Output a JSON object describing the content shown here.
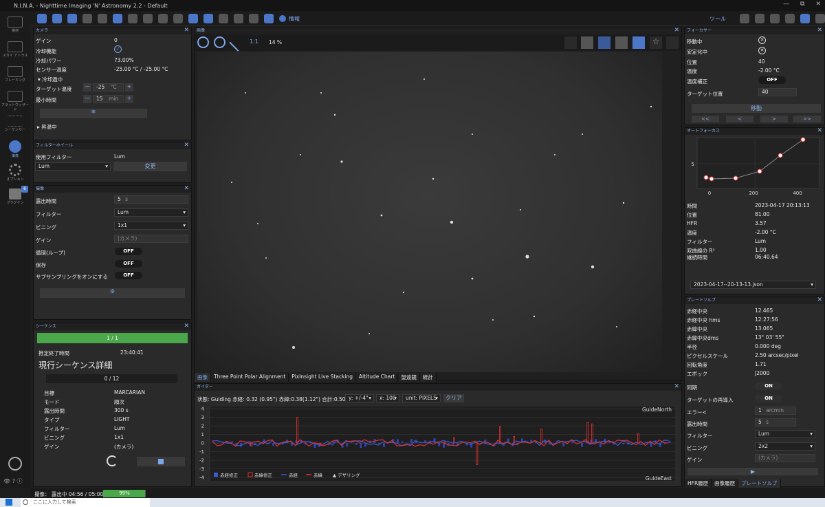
{
  "window": {
    "title": "N.I.N.A. - Nighttime Imaging 'N' Astronomy 2.2  -  Default",
    "controls": [
      "—",
      "⧉",
      "✕"
    ]
  },
  "sidebar": {
    "items": [
      {
        "label": "機材",
        "icon": "telescope-icon"
      },
      {
        "label": "スカイ アトラス",
        "icon": "map-icon"
      },
      {
        "label": "フレーミング",
        "icon": "frame-icon"
      },
      {
        "label": "フラットウィザード",
        "icon": "flat-icon"
      },
      {
        "label": "シーケンサー",
        "icon": "list-icon"
      },
      {
        "label": "撮像",
        "icon": "camera-icon"
      },
      {
        "label": "オプション",
        "icon": "gear-icon"
      },
      {
        "label": "プラグイン",
        "icon": "puzzle-icon"
      }
    ],
    "plugin_badge": "6"
  },
  "toolbar": {
    "info_label": "情報",
    "tools_label": "ツール"
  },
  "camera": {
    "header": "カメラ",
    "gain_label": "ゲイン",
    "gain": "0",
    "cooling_label": "冷却機能",
    "power_label": "冷却パワー",
    "power": "73.00%",
    "temp_label": "センサー温度",
    "temp": "-25.00 °C / -25.00 °C",
    "cooling_section": "冷却過中",
    "target_temp_label": "ターゲット温度",
    "target_temp": "-25",
    "target_unit": "°C",
    "min_time_label": "最小時間",
    "min_time": "15",
    "min_unit": "min",
    "warming": "昇温中"
  },
  "filterwheel": {
    "header": "フィルターホイール",
    "used_label": "使用フィルター",
    "used": "Lum",
    "select": "Lum",
    "change_btn": "変更"
  },
  "imaging": {
    "header": "撮像",
    "exposure_label": "露出時間",
    "exposure": "5",
    "exposure_unit": "s",
    "filter_label": "フィルター",
    "filter": "Lum",
    "binning_label": "ビニング",
    "binning": "1x1",
    "gain_label": "ゲイン",
    "gain": "(カメラ)",
    "loop_label": "循環(ループ)",
    "loop": "OFF",
    "save_label": "保存",
    "save": "OFF",
    "subsample_label": "サブサンプリングをオンにする",
    "subsample": "OFF"
  },
  "sequence": {
    "header": "シーケンス",
    "progress": "1 / 1",
    "progress_pct": 1.0,
    "eta_label": "推定終了時間",
    "eta": "23:40:41",
    "detail_title": "現行シーケンス詳細",
    "count": "0 / 12",
    "target_label": "目標",
    "target": "MARCARIAN",
    "mode_label": "モード",
    "mode": "順次",
    "exp_label": "露出時間",
    "exp": "300 s",
    "type_label": "タイプ",
    "type": "LIGHT",
    "filter_label": "フィルター",
    "filter": "Lum",
    "bin_label": "ビニング",
    "bin": "1x1",
    "gain_label": "ゲイン",
    "gain": "(カメラ)"
  },
  "image": {
    "header": "画像",
    "zoom": "14 %",
    "one_to_one": "1:1",
    "tabs": [
      "画像",
      "Three Point Polar Alignment",
      "PixInsight Live Stacking",
      "Altitude Chart",
      "望遠鏡",
      "統計"
    ]
  },
  "guider": {
    "header": "ガイダー",
    "status": "状態: Guiding  赤経: 0.32 (0.95\")  赤緯:0.38(1.12\")  合計:0.50(1.47\")",
    "y_sel": "y: +/-4\"",
    "x_sel": "x: 100",
    "unit_sel": "unit: PIXELS",
    "clear": "クリア",
    "north": "GuideNorth",
    "east": "GuideEast",
    "yticks": [
      "4",
      "3",
      "2",
      "1",
      "0",
      "-1",
      "-2",
      "-3",
      "-4"
    ],
    "legend": [
      "赤経修正",
      "赤緯修正",
      "赤経",
      "赤緯",
      "デザリング"
    ]
  },
  "focuser": {
    "header": "フォーカサー",
    "moving_label": "移動中",
    "settled_label": "安定化中",
    "pos_label": "位置",
    "pos": "40",
    "temp_label": "温度",
    "temp": "-2.00 °C",
    "comp_label": "温度補正",
    "comp": "OFF",
    "target_label": "ターゲット位置",
    "target": "40",
    "move_btn": "移動",
    "nav": [
      "<<",
      "<",
      ">",
      ">>"
    ]
  },
  "autofocus": {
    "header": "オートフォーカス",
    "time_label": "時間",
    "time": "2023-04-17 20:13:13",
    "pos_label": "位置",
    "pos": "81.00",
    "hfr_label": "HFR",
    "hfr": "3.57",
    "temp_label": "温度",
    "temp": "-2.00 °C",
    "filter_label": "フィルター",
    "filter": "Lum",
    "r2_label": "双曲線の R²",
    "r2": "1.00",
    "dur_label": "継続時間",
    "dur": "06:40.64",
    "file": "2023-04-17--20-13-13.json",
    "xticks": [
      "0",
      "200",
      "400"
    ],
    "ytick": "5"
  },
  "platesolve": {
    "header": "プレートソルブ",
    "ra_label": "赤経中央",
    "ra": "12.465",
    "ra_hms_label": "赤経中央 hms",
    "ra_hms": "12:27:56",
    "dec_label": "赤緯中央",
    "dec": "13.065",
    "dec_dms_label": "赤緯中央dms",
    "dec_dms": "13° 03' 55\"",
    "radius_label": "半径",
    "radius": "0.000 deg",
    "scale_label": "ピクセルスケール",
    "scale": "2.50 arcsec/pixel",
    "rot_label": "回転角度",
    "rot": "1.71",
    "epoch_label": "エポック",
    "epoch": "J2000",
    "sync_label": "同期",
    "sync": "ON",
    "reslew_label": "ターゲットの再導入",
    "reslew": "ON",
    "err_label": "エラー<",
    "err": "1",
    "err_unit": "arcmin",
    "exp_label": "露出時間",
    "exp": "5",
    "exp_unit": "s",
    "filter_label": "フィルター",
    "filter": "Lum",
    "bin_label": "ビニング",
    "bin": "2x2",
    "gain_label": "ゲイン",
    "gain": "(カメラ)",
    "tabs": [
      "HFR履歴",
      "画像履歴",
      "プレートソルブ"
    ]
  },
  "status": {
    "text": "撮像： 露出中 04:56 / 05:00",
    "pct": "99%",
    "pct_value": 0.99
  },
  "taskbar": {
    "search": "ここに入力して検索"
  }
}
